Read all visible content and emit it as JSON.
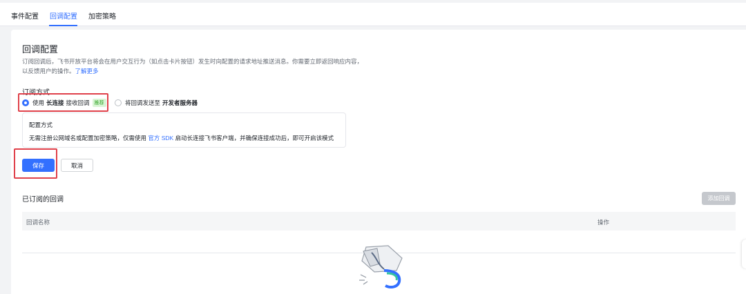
{
  "tabs": [
    {
      "label": "事件配置",
      "active": false
    },
    {
      "label": "回调配置",
      "active": true
    },
    {
      "label": "加密策略",
      "active": false
    }
  ],
  "section": {
    "title": "回调配置",
    "description": "订阅回调后，飞书开放平台将会在用户交互行为（如点击卡片按钮）发生时向配置的请求地址推送消息。你需要立即返回响应内容，以反馈用户的操作。",
    "learn_more": "了解更多"
  },
  "subscription": {
    "label": "订阅方式",
    "option_long_conn": {
      "prefix": "使用",
      "bold": "长连接",
      "suffix": "接收回调",
      "tag": "推荐",
      "checked": true
    },
    "option_server": {
      "prefix": "将回调发送至",
      "bold": "开发者服务器",
      "checked": false
    }
  },
  "config": {
    "title": "配置方式",
    "text_before": "无需注册公网域名或配置加密策略，仅需使用",
    "sdk_link": "官方 SDK",
    "text_after": "启动长连接飞书客户端，并确保连接成功后，即可开启该模式"
  },
  "actions": {
    "save": "保存",
    "cancel": "取消"
  },
  "subscribed": {
    "title": "已订阅的回调",
    "add_button": "添加回调",
    "columns": [
      "回调名称",
      "操作"
    ]
  },
  "colors": {
    "accent": "#3370ff",
    "highlight": "#e0404a",
    "tag_bg": "#d9f5d6",
    "tag_text": "#2ea121"
  }
}
